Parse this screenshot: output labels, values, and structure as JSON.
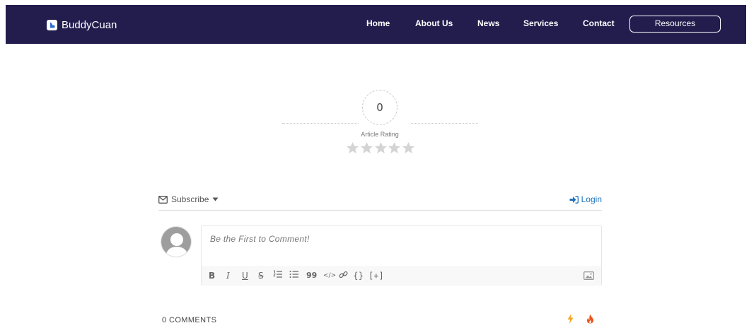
{
  "navbar": {
    "brand": "BuddyCuan",
    "links": [
      {
        "label": "Home"
      },
      {
        "label": "About Us"
      },
      {
        "label": "News"
      },
      {
        "label": "Services"
      },
      {
        "label": "Contact"
      }
    ],
    "cta_label": "Resources",
    "background": "#231d4e"
  },
  "rating": {
    "value": "0",
    "label": "Article Rating",
    "max_stars": 5,
    "filled_stars": 0
  },
  "subscribe_bar": {
    "subscribe_label": "Subscribe",
    "login_label": "Login"
  },
  "comment_form": {
    "placeholder": "Be the First to Comment!",
    "toolbar": [
      "B",
      "I",
      "U",
      "S",
      "ol",
      "ul",
      "99",
      "</>",
      "link",
      "{}",
      "[+]"
    ],
    "image_icon": "image-icon"
  },
  "comments": {
    "count_label": "0 COMMENTS",
    "sort_icons": [
      "lightning-icon",
      "flame-icon"
    ],
    "accent_orange": "#f5a623",
    "accent_red": "#e8551c"
  },
  "colors": {
    "link_blue": "#1e73be",
    "star_gray": "#d4d4d4"
  }
}
